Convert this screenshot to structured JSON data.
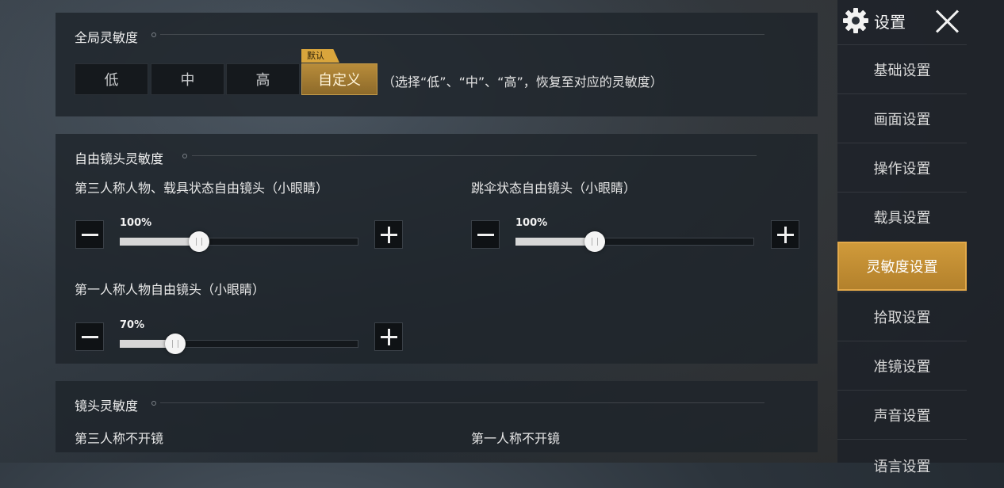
{
  "global_sensitivity": {
    "title": "全局灵敏度",
    "options": [
      "低",
      "中",
      "高",
      "自定义"
    ],
    "selected": "自定义",
    "default_tag": "默认",
    "hint": "（选择“低”、“中”、“高”，恢复至对应的灵敏度）"
  },
  "free_look": {
    "title": "自由镜头灵敏度",
    "third_person": {
      "label": "第三人称人物、载具状态自由镜头（小眼睛）",
      "value_text": "100%",
      "value": 1.0,
      "scale_max": 3.0
    },
    "parachute": {
      "label": "跳伞状态自由镜头（小眼睛）",
      "value_text": "100%",
      "value": 1.0,
      "scale_max": 3.0
    },
    "first_person": {
      "label": "第一人称人物自由镜头（小眼睛）",
      "value_text": "70%",
      "value": 0.7,
      "scale_max": 3.0
    }
  },
  "camera": {
    "title": "镜头灵敏度",
    "third_person_no_scope": "第三人称不开镜",
    "first_person_no_scope": "第一人称不开镜"
  },
  "sidebar": {
    "title": "设置",
    "items": [
      "基础设置",
      "画面设置",
      "操作设置",
      "载具设置",
      "灵敏度设置",
      "拾取设置",
      "准镜设置",
      "声音设置",
      "语言设置"
    ],
    "active": "灵敏度设置"
  },
  "colors": {
    "accent": "#c4913a",
    "panel": "#1e242b"
  }
}
